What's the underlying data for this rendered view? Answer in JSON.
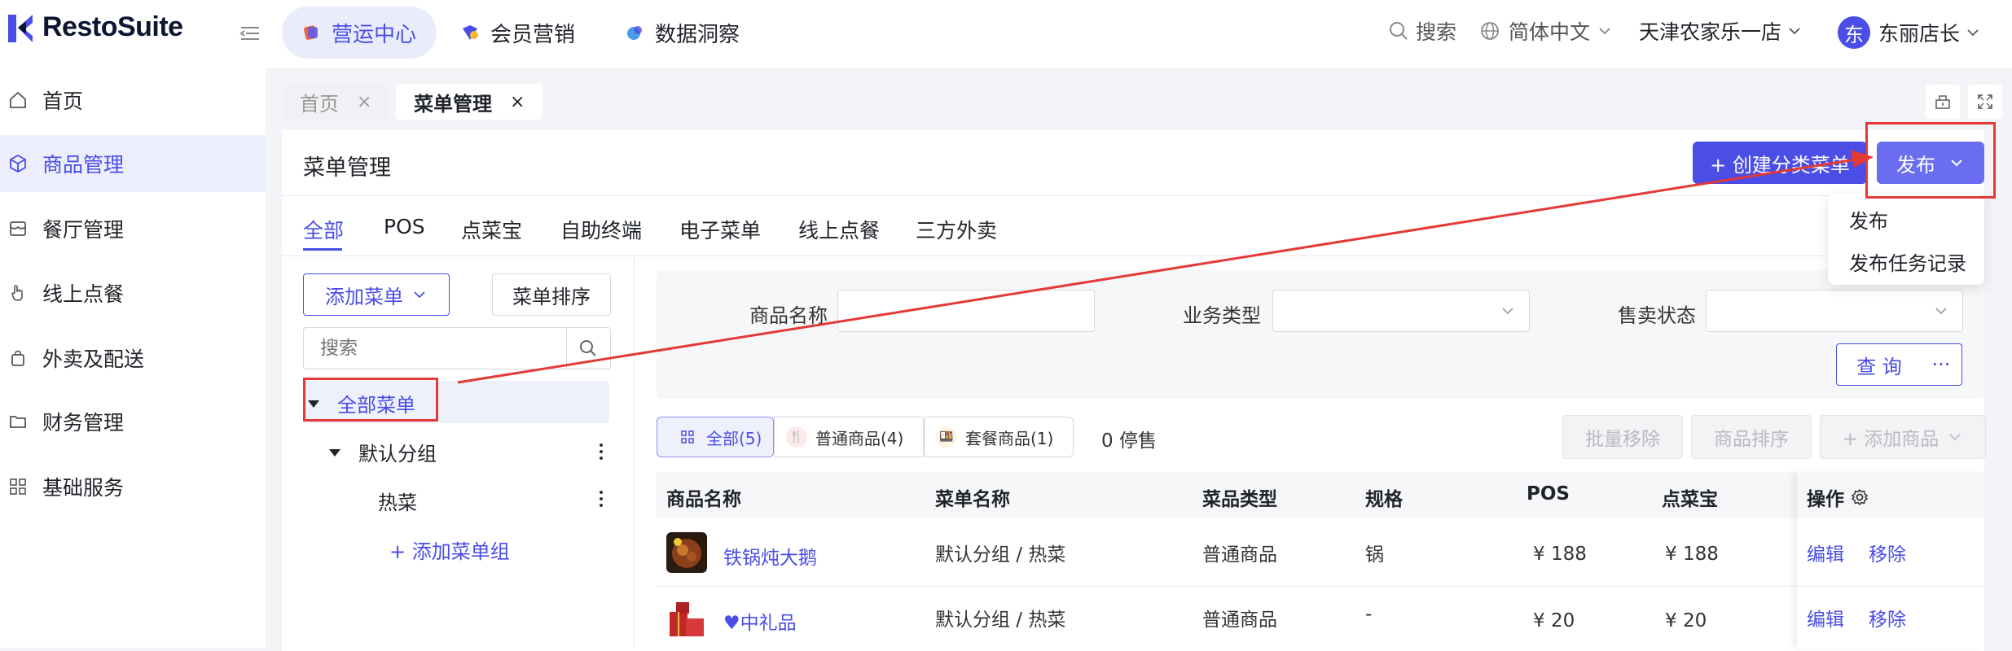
{
  "brand": {
    "name": "RestoSuite"
  },
  "top_nav": [
    {
      "label": "营运中心",
      "active": true
    },
    {
      "label": "会员营销",
      "active": false
    },
    {
      "label": "数据洞察",
      "active": false
    }
  ],
  "top_right": {
    "search": "搜索",
    "language": "简体中文",
    "store": "天津农家乐一店",
    "avatar_char": "东",
    "user": "东丽店长"
  },
  "sidebar": {
    "items": [
      {
        "label": "首页",
        "icon": "home-icon"
      },
      {
        "label": "商品管理",
        "icon": "cube-icon",
        "active": true
      },
      {
        "label": "餐厅管理",
        "icon": "store-icon"
      },
      {
        "label": "线上点餐",
        "icon": "hand-icon"
      },
      {
        "label": "外卖及配送",
        "icon": "bag-icon"
      },
      {
        "label": "财务管理",
        "icon": "folder-icon"
      },
      {
        "label": "基础服务",
        "icon": "grid-icon"
      }
    ]
  },
  "page_tabs": [
    {
      "label": "首页",
      "close": "×"
    },
    {
      "label": "菜单管理",
      "close": "×"
    }
  ],
  "page": {
    "title": "菜单管理",
    "create_button": "+ 创建分类菜单",
    "publish_button": "发布",
    "publish_menu": [
      "发布",
      "发布任务记录"
    ]
  },
  "sub_tabs": [
    "全部",
    "POS",
    "点菜宝",
    "自助终端",
    "电子菜单",
    "线上点餐",
    "三方外卖"
  ],
  "left_panel": {
    "add_menu": "添加菜单",
    "sort_menu": "菜单排序",
    "search_placeholder": "搜索",
    "tree": {
      "root": "全部菜单",
      "group": "默认分组",
      "leaf": "热菜",
      "add_group": "+ 添加菜单组"
    }
  },
  "filters": {
    "name_label": "商品名称",
    "business_label": "业务类型",
    "status_label": "售卖状态",
    "query_button": "查 询",
    "more_button": "···"
  },
  "chips": [
    {
      "label": "全部(5)",
      "active": true
    },
    {
      "label": "普通商品(4)",
      "active": false
    },
    {
      "label": "套餐商品(1)",
      "active": false
    }
  ],
  "stopped_text": "0 停售",
  "actions": {
    "batch_remove": "批量移除",
    "sort_items": "商品排序",
    "add_item": "+ 添加商品"
  },
  "table": {
    "headers": [
      "商品名称",
      "菜单名称",
      "菜品类型",
      "规格",
      "POS",
      "点菜宝",
      "操作"
    ],
    "rows": [
      {
        "name": "铁锅炖大鹅",
        "menu": "默认分组 / 热菜",
        "type": "普通商品",
        "spec": "锅",
        "pos": "¥  188",
        "dcb": "¥  188",
        "edit": "编辑",
        "remove": "移除"
      },
      {
        "name": "♥中礼品",
        "menu": "默认分组 / 热菜",
        "type": "普通商品",
        "spec": "-",
        "pos": "¥  20",
        "dcb": "¥  20",
        "edit": "编辑",
        "remove": "移除"
      }
    ]
  },
  "colors": {
    "accent": "#4a4de6",
    "annotation": "#e53935"
  }
}
